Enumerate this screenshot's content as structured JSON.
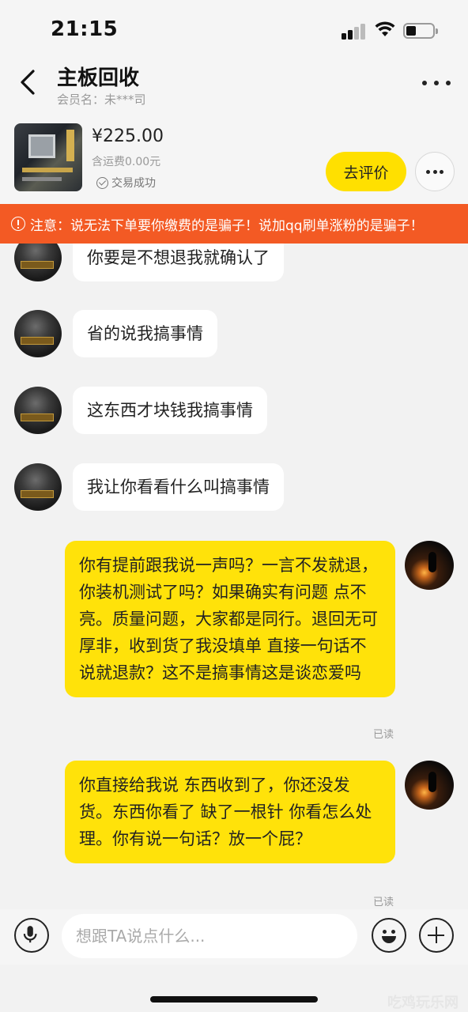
{
  "status_bar": {
    "time": "21:15"
  },
  "header": {
    "title": "主板回收",
    "member": "会员名：未***司"
  },
  "product": {
    "price": "¥225.00",
    "shipping": "含运费0.00元",
    "status": "交易成功",
    "review_label": "去评价"
  },
  "warning": {
    "text": "注意：说无法下单要你缴费的是骗子！说加qq刷单涨粉的是骗子！"
  },
  "messages": [
    {
      "side": "left",
      "text": "你要是不想退我就确认了"
    },
    {
      "side": "left",
      "text": "省的说我搞事情"
    },
    {
      "side": "left",
      "text": "这东西才块钱我搞事情"
    },
    {
      "side": "left",
      "text": "我让你看看什么叫搞事情"
    },
    {
      "side": "right",
      "text": "你有提前跟我说一声吗？一言不发就退，你装机测试了吗？如果确实有问题 点不亮。质量问题，大家都是同行。退回无可厚非，收到货了我没填单 直接一句话不说就退款？这不是搞事情这是谈恋爱吗",
      "status": "已读"
    },
    {
      "side": "right",
      "text": "你直接给我说 东西收到了，你还没发货。东西你看了 缺了一根针  你看怎么处理。你有说一句话？放一个屁？",
      "status": "已读"
    }
  ],
  "input": {
    "placeholder": "想跟TA说点什么..."
  },
  "watermark": "吃鸡玩乐网"
}
